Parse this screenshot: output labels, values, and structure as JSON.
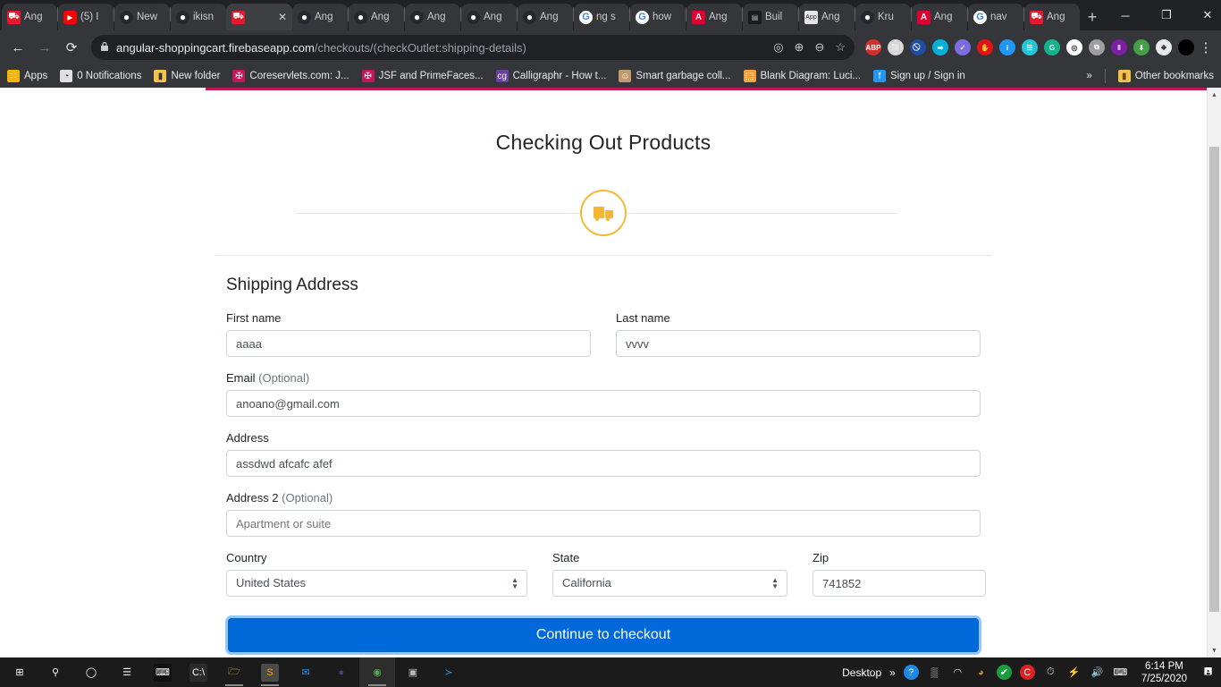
{
  "browser": {
    "tabs": [
      {
        "title": "Ang",
        "favicon": "cart-icon",
        "fav_class": "fav-cart",
        "glyph": "⛟",
        "active": false
      },
      {
        "title": "(5) I",
        "favicon": "youtube-icon",
        "fav_class": "fav-yt",
        "glyph": "▶",
        "active": false
      },
      {
        "title": "New",
        "favicon": "github-icon",
        "fav_class": "fav-gh",
        "glyph": "●",
        "active": false
      },
      {
        "title": "ikisn",
        "favicon": "github-icon",
        "fav_class": "fav-gh",
        "glyph": "●",
        "active": false
      },
      {
        "title": "",
        "favicon": "cart-icon",
        "fav_class": "fav-cart",
        "glyph": "⛟",
        "active": true
      },
      {
        "title": "Ang",
        "favicon": "github-icon",
        "fav_class": "fav-gh",
        "glyph": "●",
        "active": false
      },
      {
        "title": "Ang",
        "favicon": "github-icon",
        "fav_class": "fav-gh",
        "glyph": "●",
        "active": false
      },
      {
        "title": "Ang",
        "favicon": "github-icon",
        "fav_class": "fav-gh",
        "glyph": "●",
        "active": false
      },
      {
        "title": "Ang",
        "favicon": "github-icon",
        "fav_class": "fav-gh",
        "glyph": "●",
        "active": false
      },
      {
        "title": "Ang",
        "favicon": "github-icon",
        "fav_class": "fav-gh",
        "glyph": "●",
        "active": false
      },
      {
        "title": "ng s",
        "favicon": "google-icon",
        "fav_class": "fav-google",
        "glyph": "G",
        "active": false
      },
      {
        "title": "how",
        "favicon": "google-icon",
        "fav_class": "fav-google",
        "glyph": "G",
        "active": false
      },
      {
        "title": "Ang",
        "favicon": "angular-icon",
        "fav_class": "fav-ng",
        "glyph": "A",
        "active": false
      },
      {
        "title": "Buil",
        "favicon": "dark-site-icon",
        "fav_class": "fav-dark",
        "glyph": "▤",
        "active": false
      },
      {
        "title": "Ang",
        "favicon": "app-icon",
        "fav_class": "fav-app",
        "glyph": "App",
        "active": false
      },
      {
        "title": "Kru",
        "favicon": "github-icon",
        "fav_class": "fav-gh",
        "glyph": "●",
        "active": false
      },
      {
        "title": "Ang",
        "favicon": "angular-icon",
        "fav_class": "fav-ng",
        "glyph": "A",
        "active": false
      },
      {
        "title": "nav",
        "favicon": "google-icon",
        "fav_class": "fav-google",
        "glyph": "G",
        "active": false
      },
      {
        "title": "Ang",
        "favicon": "cart-icon",
        "fav_class": "fav-cart",
        "glyph": "⛟",
        "active": false
      }
    ],
    "new_tab_label": "+",
    "close_tab_label": "✕",
    "window_controls": {
      "minimize": "─",
      "maximize": "❐",
      "close": "✕"
    },
    "nav": {
      "back": "←",
      "forward": "→",
      "reload": "⟳"
    },
    "omnibox": {
      "lock_icon": "🔒",
      "host": "angular-shoppingcart.firebaseapp.com",
      "path": "/checkouts/(checkOutlet:shipping-details)",
      "inline_icons": [
        "⌖",
        "⊕",
        "⊖",
        "☆"
      ]
    },
    "extensions": [
      {
        "name": "adblock-plus-icon",
        "label": "ABP",
        "color": "#d32f2f"
      },
      {
        "name": "box-icon",
        "label": "⬜",
        "color": "#d9d9d9"
      },
      {
        "name": "block-icon",
        "label": "⃠",
        "color": "#1f4ea1"
      },
      {
        "name": "export-icon",
        "label": "➡",
        "color": "#00b0d8"
      },
      {
        "name": "check-shield-icon",
        "label": "✓",
        "color": "#7c6ce0"
      },
      {
        "name": "stop-hand-icon",
        "label": "✋",
        "color": "#e01414"
      },
      {
        "name": "info-icon",
        "label": "i",
        "color": "#2196f3"
      },
      {
        "name": "notes-icon",
        "label": "☰",
        "color": "#26c6da"
      },
      {
        "name": "grammarly-icon",
        "label": "G",
        "color": "#11b48a"
      },
      {
        "name": "goggles-icon",
        "label": "◎",
        "color": "#ffffff"
      },
      {
        "name": "copy-icon",
        "label": "⧉",
        "color": "#9e9e9e"
      },
      {
        "name": "library-icon",
        "label": "‖",
        "color": "#7b1fa2"
      },
      {
        "name": "download-icon",
        "label": "⬇",
        "color": "#43a047"
      },
      {
        "name": "puzzle-icon",
        "label": "❖",
        "color": "#e8eaed"
      },
      {
        "name": "profile-avatar",
        "label": "",
        "color": "#000000"
      }
    ],
    "menu_icon": "⋮",
    "bookmarks": [
      {
        "label": "Apps",
        "icon": "apps-grid-icon",
        "glyph": "∷",
        "color": "#f4b400",
        "text_color": "#e8eaed"
      },
      {
        "label": "0 Notifications",
        "icon": "globe-icon",
        "glyph": "◔",
        "color": "#e0e0e0",
        "text_color": "#e8eaed"
      },
      {
        "label": "New folder",
        "icon": "folder-icon",
        "glyph": "▮",
        "color": "#f2c14e",
        "text_color": "#e8eaed"
      },
      {
        "label": "Coreservlets.com: J...",
        "icon": "bookmark-site-icon",
        "glyph": "✠",
        "color": "#c2185b",
        "text_color": "#e8eaed"
      },
      {
        "label": "JSF and PrimeFaces...",
        "icon": "bookmark-site-icon",
        "glyph": "✠",
        "color": "#c2185b",
        "text_color": "#e8eaed"
      },
      {
        "label": "Calligraphr - How t...",
        "icon": "calligraphr-icon",
        "glyph": "cg",
        "color": "#6b3fa0",
        "text_color": "#e8eaed"
      },
      {
        "label": "Smart garbage coll...",
        "icon": "avatar-icon",
        "glyph": "☺",
        "color": "#c39a6b",
        "text_color": "#e8eaed"
      },
      {
        "label": "Blank Diagram: Luci...",
        "icon": "lucidchart-icon",
        "glyph": "⬚",
        "color": "#f2a33c",
        "text_color": "#e8eaed"
      },
      {
        "label": "Sign up / Sign in",
        "icon": "figma-icon",
        "glyph": "f",
        "color": "#2196f3",
        "text_color": "#e8eaed"
      }
    ],
    "overflow_label": "»",
    "other_bookmarks": {
      "label": "Other bookmarks",
      "icon": "folder-icon",
      "glyph": "▮",
      "color": "#f2c14e"
    }
  },
  "page": {
    "title": "Checking Out Products",
    "stepper": {
      "step_icon": "shipping-truck-icon",
      "accent": "#f5b731"
    },
    "form": {
      "section_title": "Shipping Address",
      "fields": {
        "first_name": {
          "label": "First name",
          "value": "aaaa",
          "placeholder": ""
        },
        "last_name": {
          "label": "Last name",
          "value": "vvvv",
          "placeholder": ""
        },
        "email": {
          "label": "Email",
          "optional": " (Optional)",
          "value": "anoano@gmail.com",
          "placeholder": ""
        },
        "address": {
          "label": "Address",
          "value": "assdwd afcafc afef",
          "placeholder": ""
        },
        "address2": {
          "label": "Address 2",
          "optional": " (Optional)",
          "value": "",
          "placeholder": "Apartment or suite"
        },
        "country": {
          "label": "Country",
          "value": "United States"
        },
        "state": {
          "label": "State",
          "value": "California"
        },
        "zip": {
          "label": "Zip",
          "value": "741852",
          "placeholder": ""
        }
      },
      "submit_label": "Continue to checkout",
      "submit_color": "#0069d9"
    }
  },
  "taskbar": {
    "items": [
      {
        "name": "start-button",
        "glyph": "⊞",
        "color": "#ffffff",
        "bg": "",
        "active": false,
        "running": false
      },
      {
        "name": "search-icon",
        "glyph": "⚲",
        "color": "#ffffff",
        "bg": "",
        "active": false,
        "running": false
      },
      {
        "name": "cortana-icon",
        "glyph": "◯",
        "color": "#ffffff",
        "bg": "",
        "active": false,
        "running": false
      },
      {
        "name": "task-view-icon",
        "glyph": "☰",
        "color": "#ffffff",
        "bg": "",
        "active": false,
        "running": false
      },
      {
        "name": "terminal-app-icon",
        "glyph": "⌨",
        "color": "#ffffff",
        "bg": "#111111",
        "active": false,
        "running": false
      },
      {
        "name": "command-prompt-icon",
        "glyph": "C:\\",
        "color": "#ffffff",
        "bg": "#2b2b2b",
        "active": false,
        "running": false
      },
      {
        "name": "file-explorer-icon",
        "glyph": "🗁",
        "color": "#f2b33d",
        "bg": "",
        "active": false,
        "running": true
      },
      {
        "name": "sublime-text-icon",
        "glyph": "S",
        "color": "#ff9800",
        "bg": "#4a4a4a",
        "active": false,
        "running": true
      },
      {
        "name": "mail-icon",
        "glyph": "✉",
        "color": "#2196f3",
        "bg": "",
        "active": false,
        "running": false
      },
      {
        "name": "ellipse-app-icon",
        "glyph": "●",
        "color": "#4a3f7a",
        "bg": "",
        "active": false,
        "running": false
      },
      {
        "name": "chrome-icon",
        "glyph": "◉",
        "color": "#4caf50",
        "bg": "",
        "active": true,
        "running": true
      },
      {
        "name": "monitor-app-icon",
        "glyph": "▣",
        "color": "#bdbdbd",
        "bg": "",
        "active": false,
        "running": false
      },
      {
        "name": "vscode-icon",
        "glyph": "≻",
        "color": "#2196f3",
        "bg": "",
        "active": false,
        "running": false
      }
    ],
    "tray": {
      "desktop_label": "Desktop",
      "overflow": "»",
      "icons": [
        {
          "name": "help-question-icon",
          "glyph": "?",
          "color": "#ffffff",
          "bg": "#1e88e5"
        },
        {
          "name": "grid-icon",
          "glyph": "▒",
          "color": "#cccccc",
          "bg": ""
        },
        {
          "name": "wifi-icon",
          "glyph": "◠",
          "color": "#dddddd",
          "bg": ""
        },
        {
          "name": "disc-icon",
          "glyph": "◕",
          "color": "#c8913c",
          "bg": ""
        },
        {
          "name": "security-shield-icon",
          "glyph": "✔",
          "color": "#ffffff",
          "bg": "#1a9c3f"
        },
        {
          "name": "ccleaner-icon",
          "glyph": "C",
          "color": "#ffffff",
          "bg": "#e02020"
        },
        {
          "name": "clock-app-icon",
          "glyph": "⏱",
          "color": "#dddddd",
          "bg": ""
        },
        {
          "name": "plug-icon",
          "glyph": "⚡",
          "color": "#dddddd",
          "bg": ""
        },
        {
          "name": "volume-icon",
          "glyph": "🔊",
          "color": "#ffffff",
          "bg": ""
        },
        {
          "name": "keyboard-icon",
          "glyph": "⌨",
          "color": "#ffffff",
          "bg": ""
        }
      ],
      "time": "6:14 PM",
      "date": "7/25/2020",
      "action_center_icon": "🖪"
    }
  }
}
